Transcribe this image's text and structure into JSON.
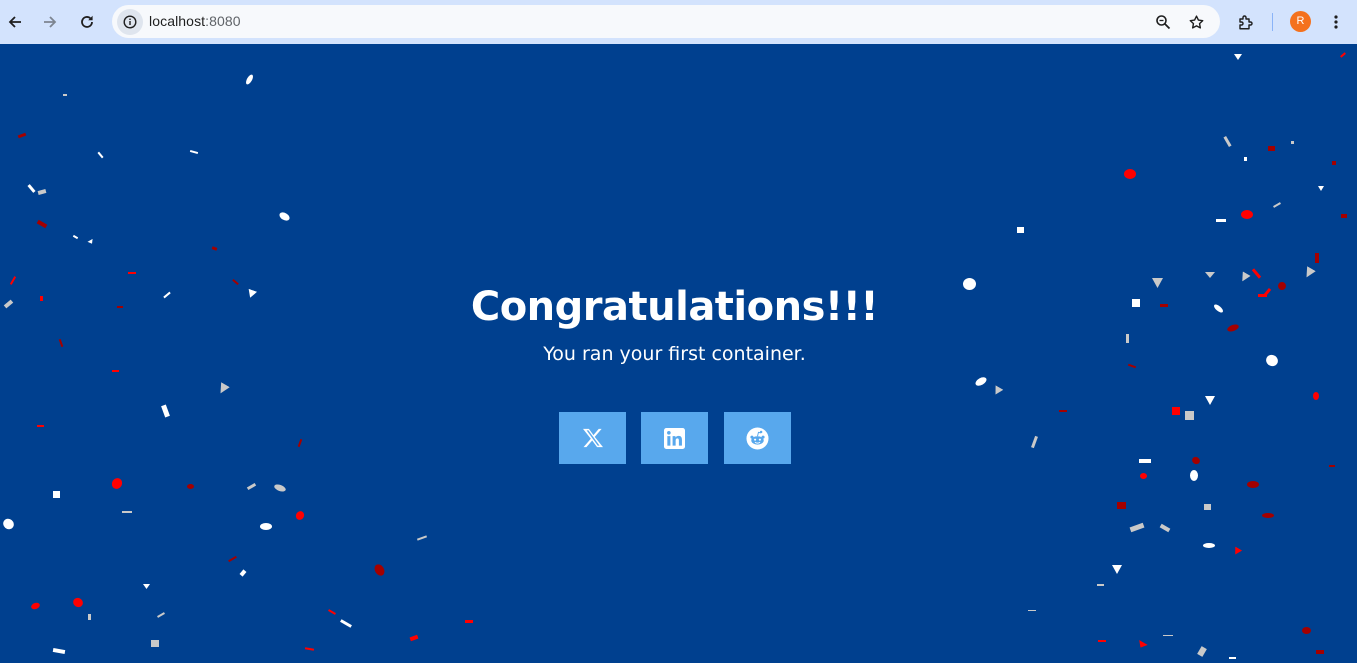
{
  "browser": {
    "url_host": "localhost",
    "url_port": ":8080",
    "profile_initial": "R",
    "toolbar_icons": [
      "back-icon",
      "forward-icon",
      "reload-icon",
      "site-info-icon",
      "zoom-icon",
      "bookmark-star-icon",
      "extensions-icon",
      "menu-kebab-icon"
    ]
  },
  "page": {
    "title": "Congratulations!!!",
    "subtitle": "You ran your first container.",
    "share_buttons": [
      {
        "name": "x-share-button",
        "icon": "x-logo-icon"
      },
      {
        "name": "linkedin-share-button",
        "icon": "linkedin-logo-icon"
      },
      {
        "name": "reddit-share-button",
        "icon": "reddit-logo-icon"
      }
    ]
  },
  "colors": {
    "background": "#00408f",
    "chrome": "#d3e3fd",
    "share_button": "#58a8ed",
    "confetti": [
      "#ffffff",
      "#c9c9c9",
      "#ff0000",
      "#a30000"
    ]
  }
}
